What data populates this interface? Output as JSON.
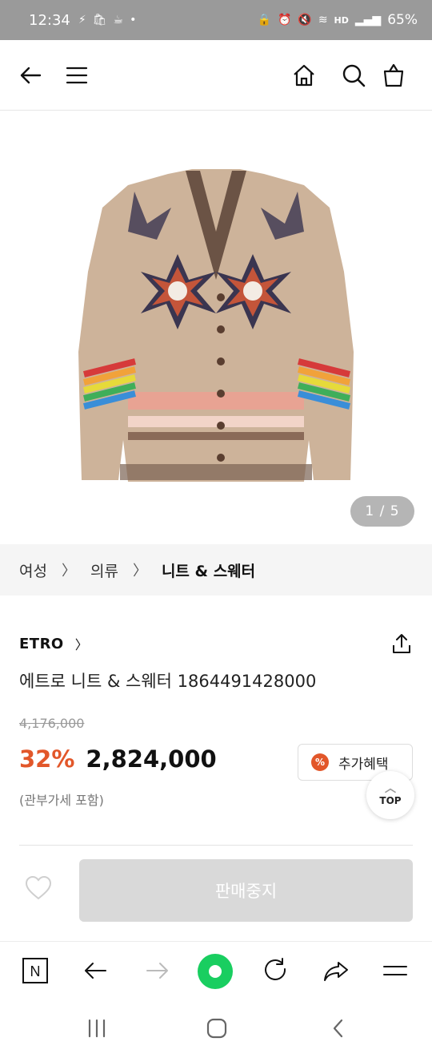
{
  "status_bar": {
    "time": "12:34",
    "battery": "65%",
    "hd_label": "HD"
  },
  "product": {
    "image_pager": "1 / 5",
    "brand": "ETRO",
    "title": "에트로 니트 & 스웨터 1864491428000",
    "original_price": "4,176,000",
    "discount": "32%",
    "price": "2,824,000",
    "vat_note": "(관부가세 포함)",
    "benefit_label": "추가혜택",
    "benefit_badge": "%",
    "sold_out_label": "판매중지"
  },
  "breadcrumb": {
    "items": [
      "여성",
      "의류",
      "니트 & 스웨터"
    ]
  },
  "floating": {
    "top_label": "TOP"
  },
  "browser_bar": {
    "n_label": "N"
  },
  "colors": {
    "accent": "#e2572a",
    "naver_green": "#19ce60",
    "disabled_button": "#d9d9d9"
  }
}
